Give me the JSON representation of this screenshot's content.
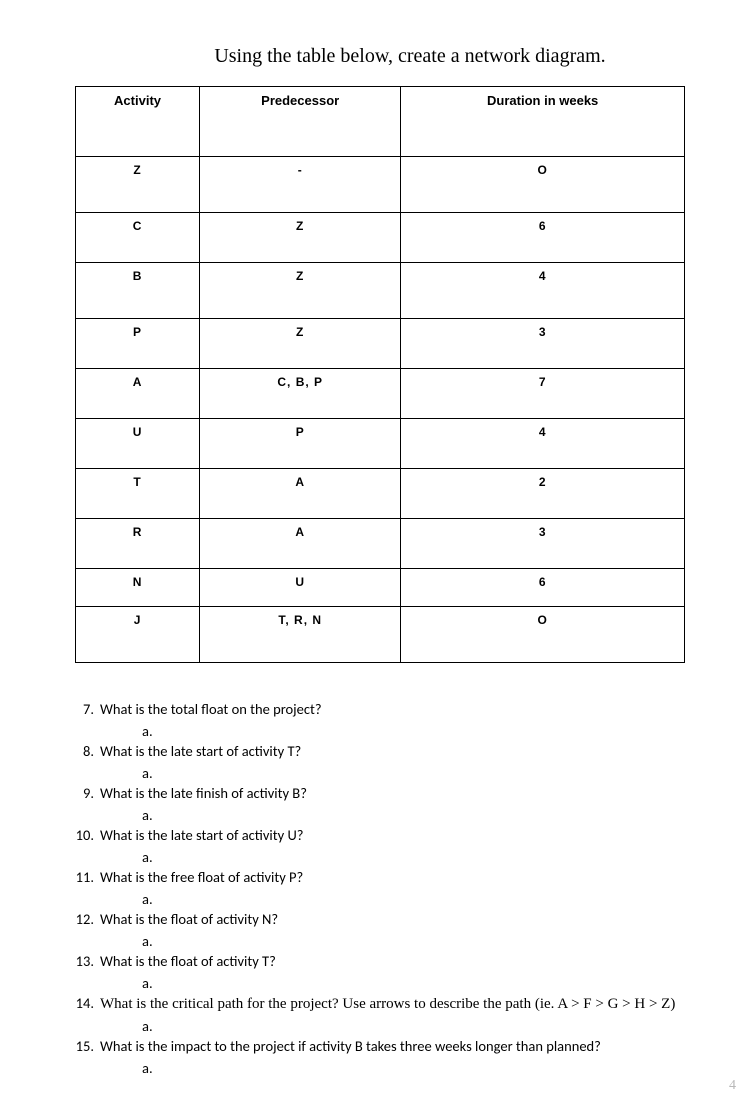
{
  "title": "Using the table below, create a network diagram.",
  "table": {
    "headers": [
      "Activity",
      "Predecessor",
      "Duration in weeks"
    ],
    "rows": [
      {
        "activity": "Z",
        "predecessor": "-",
        "duration": "O",
        "cls": "tall"
      },
      {
        "activity": "C",
        "predecessor": "Z",
        "duration": "6",
        "cls": ""
      },
      {
        "activity": "B",
        "predecessor": "Z",
        "duration": "4",
        "cls": "tall"
      },
      {
        "activity": "P",
        "predecessor": "Z",
        "duration": "3",
        "cls": ""
      },
      {
        "activity": "A",
        "predecessor": "C, B, P",
        "duration": "7",
        "cls": ""
      },
      {
        "activity": "U",
        "predecessor": "P",
        "duration": "4",
        "cls": ""
      },
      {
        "activity": "T",
        "predecessor": "A",
        "duration": "2",
        "cls": ""
      },
      {
        "activity": "R",
        "predecessor": "A",
        "duration": "3",
        "cls": ""
      },
      {
        "activity": "N",
        "predecessor": "U",
        "duration": "6",
        "cls": "short"
      },
      {
        "activity": "J",
        "predecessor": "T, R, N",
        "duration": "O",
        "cls": "tall"
      }
    ]
  },
  "questions": [
    {
      "n": "7.",
      "text": "What is the total float on the project?",
      "sub": "a.",
      "serif": false
    },
    {
      "n": "8.",
      "text": "What is the late start of activity T?",
      "sub": "a.",
      "serif": false
    },
    {
      "n": "9.",
      "text": "What is the late finish of activity B?",
      "sub": "a.",
      "serif": false
    },
    {
      "n": "10.",
      "text": "What is the late start of activity U?",
      "sub": "a.",
      "serif": false
    },
    {
      "n": "11.",
      "text": "What is the free float of activity P?",
      "sub": "a.",
      "serif": false
    },
    {
      "n": "12.",
      "text": "What is the float of activity N?",
      "sub": "a.",
      "serif": false
    },
    {
      "n": "13.",
      "text": "What is the float of activity T?",
      "sub": "a.",
      "serif": false
    },
    {
      "n": "14.",
      "text": "What is the critical path for the project? Use arrows to describe the path (ie. A > F > G > H > Z)",
      "sub": "a.",
      "serif": true
    },
    {
      "n": "15.",
      "text": "What is the impact to the project if activity B takes three weeks longer than planned?",
      "sub": "a.",
      "serif": false
    }
  ],
  "page_number": "4"
}
